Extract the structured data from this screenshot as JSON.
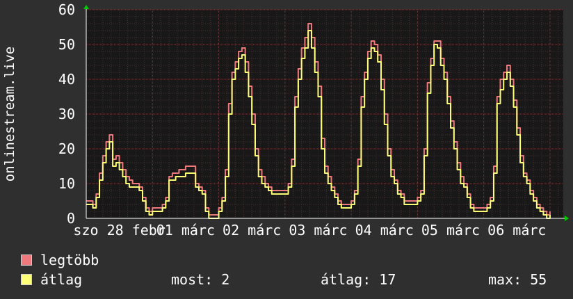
{
  "chart_data": {
    "type": "line",
    "ylabel": "onlinestream.live",
    "ylim": [
      0,
      60
    ],
    "yticks": [
      "0",
      "10",
      "20",
      "30",
      "40",
      "50",
      "60"
    ],
    "x_tick_labels": [
      "szo 28 febr",
      "01 márc",
      "02 márc",
      "03 márc",
      "04 márc",
      "05 márc",
      "06 márc"
    ],
    "grid": true,
    "x_start": 0,
    "x_end": 7.2,
    "x": [
      0,
      0.05,
      0.1,
      0.15,
      0.2,
      0.25,
      0.3,
      0.35,
      0.4,
      0.45,
      0.5,
      0.55,
      0.6,
      0.65,
      0.7,
      0.75,
      0.8,
      0.85,
      0.9,
      0.95,
      1.0,
      1.05,
      1.1,
      1.15,
      1.2,
      1.25,
      1.3,
      1.35,
      1.4,
      1.45,
      1.5,
      1.55,
      1.6,
      1.65,
      1.7,
      1.75,
      1.8,
      1.85,
      1.9,
      1.95,
      2.0,
      2.05,
      2.1,
      2.15,
      2.2,
      2.25,
      2.3,
      2.35,
      2.4,
      2.45,
      2.5,
      2.55,
      2.6,
      2.65,
      2.7,
      2.75,
      2.8,
      2.85,
      2.9,
      2.95,
      3.0,
      3.05,
      3.1,
      3.15,
      3.2,
      3.25,
      3.3,
      3.35,
      3.4,
      3.45,
      3.5,
      3.55,
      3.6,
      3.65,
      3.7,
      3.75,
      3.8,
      3.85,
      3.9,
      3.95,
      4.0,
      4.05,
      4.1,
      4.15,
      4.2,
      4.25,
      4.3,
      4.35,
      4.4,
      4.45,
      4.5,
      4.55,
      4.6,
      4.65,
      4.7,
      4.75,
      4.8,
      4.85,
      4.9,
      4.95,
      5.0,
      5.05,
      5.1,
      5.15,
      5.2,
      5.25,
      5.3,
      5.35,
      5.4,
      5.45,
      5.5,
      5.55,
      5.6,
      5.65,
      5.7,
      5.75,
      5.8,
      5.85,
      5.9,
      5.95,
      6.0,
      6.05,
      6.1,
      6.15,
      6.2,
      6.25,
      6.3,
      6.35,
      6.4,
      6.45,
      6.5,
      6.55,
      6.6,
      6.65,
      6.7,
      6.75,
      6.8,
      6.85,
      6.9,
      6.95,
      7.0,
      7.05,
      7.1,
      7.15,
      7.2
    ],
    "series": [
      {
        "name": "legtöbb",
        "color": "#ee7a7e",
        "values": [
          5,
          5,
          4,
          7,
          13,
          18,
          22,
          24,
          17,
          18,
          16,
          14,
          12,
          11,
          10,
          10,
          9,
          6,
          3,
          2,
          3,
          3,
          3,
          4,
          6,
          12,
          13,
          13,
          14,
          14,
          15,
          15,
          15,
          10,
          9,
          8,
          3,
          1,
          1,
          1,
          3,
          6,
          14,
          33,
          42,
          45,
          48,
          49,
          45,
          38,
          30,
          20,
          14,
          12,
          10,
          9,
          8,
          8,
          8,
          8,
          8,
          10,
          17,
          35,
          43,
          49,
          52,
          56,
          52,
          45,
          38,
          23,
          15,
          12,
          9,
          7,
          5,
          4,
          4,
          4,
          5,
          8,
          17,
          35,
          42,
          48,
          51,
          50,
          47,
          40,
          30,
          20,
          14,
          11,
          8,
          7,
          5,
          5,
          5,
          5,
          6,
          8,
          20,
          39,
          46,
          51,
          51,
          46,
          42,
          35,
          28,
          22,
          16,
          12,
          10,
          7,
          4,
          3,
          3,
          3,
          3,
          4,
          6,
          15,
          35,
          40,
          42,
          44,
          40,
          34,
          26,
          18,
          13,
          11,
          8,
          6,
          4,
          3,
          2,
          1,
          2
        ],
        "xlim": [
          0,
          7.2
        ]
      },
      {
        "name": "átlag",
        "color": "#ffff77",
        "values": [
          4,
          4,
          3,
          6,
          11,
          16,
          20,
          22,
          15,
          16,
          14,
          12,
          10,
          9,
          9,
          9,
          8,
          5,
          2,
          1,
          2,
          2,
          2,
          3,
          5,
          11,
          11,
          12,
          12,
          12,
          13,
          13,
          13,
          9,
          8,
          7,
          2,
          0,
          0,
          0,
          2,
          5,
          12,
          30,
          40,
          43,
          46,
          47,
          42,
          35,
          27,
          18,
          12,
          10,
          9,
          8,
          7,
          7,
          7,
          7,
          7,
          9,
          15,
          32,
          40,
          46,
          49,
          54,
          49,
          42,
          35,
          20,
          13,
          10,
          8,
          6,
          4,
          3,
          3,
          3,
          4,
          7,
          15,
          32,
          40,
          46,
          49,
          48,
          45,
          37,
          27,
          18,
          12,
          10,
          7,
          6,
          4,
          4,
          4,
          4,
          5,
          7,
          18,
          36,
          44,
          50,
          49,
          44,
          40,
          33,
          26,
          20,
          14,
          10,
          9,
          6,
          3,
          2,
          2,
          2,
          2,
          3,
          5,
          13,
          33,
          37,
          40,
          42,
          38,
          32,
          24,
          16,
          12,
          10,
          7,
          5,
          3,
          2,
          1,
          0,
          1
        ]
      }
    ]
  },
  "stats": {
    "now_label": "most:",
    "now_value": "2",
    "avg_label": "átlag:",
    "avg_value": "17",
    "max_label": "max:",
    "max_value": "55"
  }
}
